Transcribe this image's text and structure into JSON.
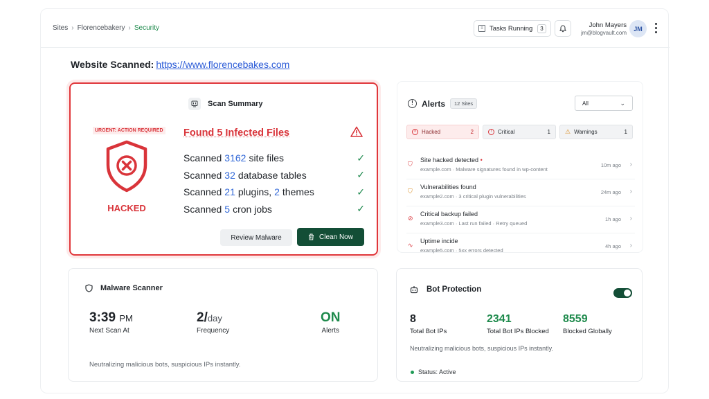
{
  "breadcrumb": [
    "Sites",
    "Florencebakery",
    "Security"
  ],
  "header": {
    "tasks_label": "Tasks Running",
    "tasks_count": "3",
    "user_name": "John Mayers",
    "user_email": "jm@blogvault.com",
    "user_initials": "JM"
  },
  "site": {
    "label": "Website Scanned:",
    "url": "https://www.florencebakes.com"
  },
  "scan": {
    "title": "Scan Summary",
    "urgent": "URGENT: ACTION REQUIRED",
    "status": "HACKED",
    "found": "Found 5 Infected Files",
    "stats": [
      {
        "pre": "Scanned",
        "num": "3162",
        "post": "site files"
      },
      {
        "pre": "Scanned",
        "num": "32",
        "post": "database tables"
      },
      {
        "pre": "Scanned",
        "num": "21",
        "post": "plugins,",
        "num2": "2",
        "post2": "themes"
      },
      {
        "pre": "Scanned",
        "num": "5",
        "post": "cron jobs"
      }
    ],
    "review_label": "Review Malware",
    "clean_label": "Clean Now"
  },
  "alerts": {
    "title": "Alerts",
    "sites_badge": "12 Sites",
    "filter_value": "All",
    "chips": [
      {
        "label": "Hacked",
        "count": "2"
      },
      {
        "label": "Critical",
        "count": "1"
      },
      {
        "label": "Warnings",
        "count": "1"
      }
    ],
    "items": [
      {
        "title": "Site hacked detected",
        "sub": "example.com · Malware signatures found in wp-content",
        "time": "10m ago"
      },
      {
        "title": "Vulnerabilities found",
        "sub": "example2.com · 3 critical plugin vulnerabilities",
        "time": "24m ago"
      },
      {
        "title": "Critical backup failed",
        "sub": "example3.com · Last run failed · Retry queued",
        "time": "1h ago"
      },
      {
        "title": "Uptime incide",
        "sub": "example5.com · 5xx errors detected",
        "time": "4h ago"
      }
    ]
  },
  "malware": {
    "title": "Malware Scanner",
    "next_scan_value": "3:39",
    "next_scan_unit": "PM",
    "next_scan_label": "Next Scan At",
    "freq_value": "2/",
    "freq_unit": "day",
    "freq_label": "Frequency",
    "alerts_value": "ON",
    "alerts_label": "Alerts",
    "footer": "Neutralizing malicious bots, suspicious IPs instantly."
  },
  "bot": {
    "title": "Bot Protection",
    "stats": [
      {
        "value": "8",
        "label": "Total Bot IPs"
      },
      {
        "value": "2341",
        "label": "Total Bot IPs Blocked"
      },
      {
        "value": "8559",
        "label": "Blocked Globally"
      }
    ],
    "footer": "Neutralizing malicious bots, suspicious IPs instantly.",
    "status": "Status: Active"
  },
  "colors": {
    "danger": "#d9343a",
    "brand_green": "#134e36",
    "accent_blue": "#3067d7",
    "success": "#1e8a4c"
  }
}
